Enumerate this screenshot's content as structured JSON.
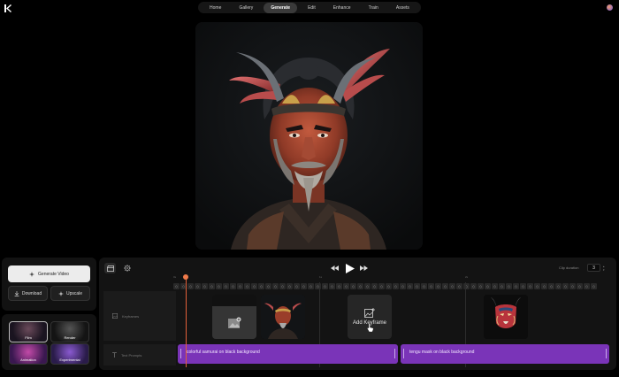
{
  "nav": {
    "tabs": [
      {
        "label": "Home"
      },
      {
        "label": "Gallery"
      },
      {
        "label": "Generate",
        "active": true
      },
      {
        "label": "Edit"
      },
      {
        "label": "Enhance"
      },
      {
        "label": "Train"
      },
      {
        "label": "Assets"
      }
    ]
  },
  "icons": {
    "logo": "logo-icon",
    "avatar": "user-avatar",
    "generate": "sparkle-icon",
    "download": "download-icon",
    "upscale": "upscale-icon",
    "clapper": "clapperboard-icon",
    "settings": "gear-icon",
    "rewind": "rewind-icon",
    "play": "play-icon",
    "forward": "fast-forward-icon",
    "keyframes": "image-icon",
    "text_prompts": "text-icon",
    "add_keyframe": "image-plus-icon"
  },
  "actions": {
    "generate_video": "Generate Video",
    "download": "Download",
    "upscale": "Upscale"
  },
  "styles": [
    {
      "label": "Film"
    },
    {
      "label": "Render"
    },
    {
      "label": "Animation"
    },
    {
      "label": "Experimental"
    }
  ],
  "timeline": {
    "clip_duration_label": "Clip duration",
    "clip_duration_value": "3",
    "rows": {
      "keyframes": "Keyframes",
      "text_prompts": "Text Prompts"
    },
    "ruler": [
      "0s",
      "1s",
      "2s"
    ],
    "add_keyframe": "Add Keyframe",
    "prompts": [
      {
        "text": "colorful samurai on black background"
      },
      {
        "text": "tengu mask on black background"
      }
    ]
  },
  "colors": {
    "accent_purple": "#7a34b8",
    "playhead": "#e2603a",
    "active_tab": "#3a3a3a"
  }
}
